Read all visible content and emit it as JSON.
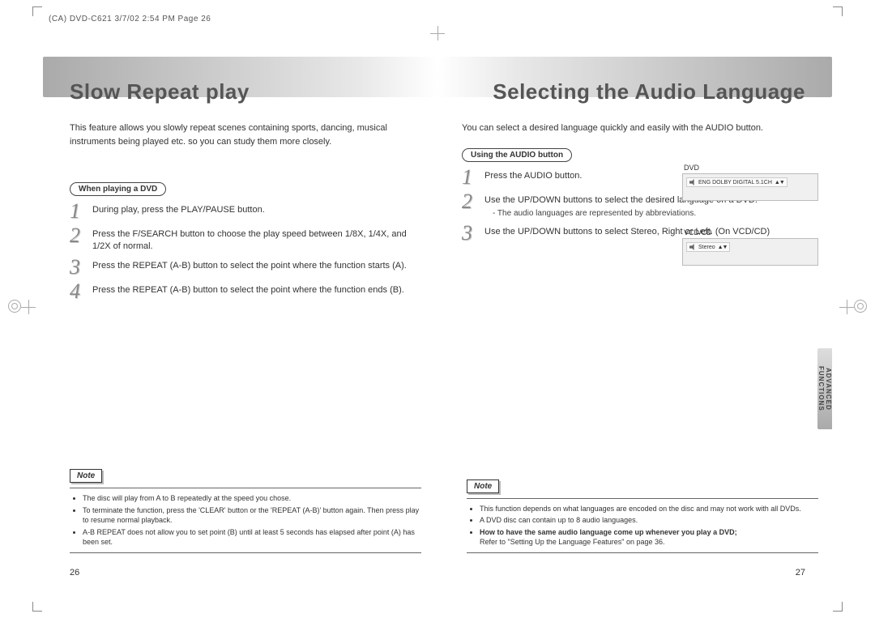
{
  "meta": {
    "header": "(CA) DVD-C621  3/7/02  2:54 PM  Page 26"
  },
  "left": {
    "title": "Slow Repeat play",
    "intro": "This feature allows you slowly repeat scenes containing sports, dancing, musical instruments being played etc. so you can study them more closely.",
    "pill": "When playing a DVD",
    "steps": [
      "During play, press the PLAY/PAUSE button.",
      "Press the F/SEARCH button to choose the play speed between 1/8X, 1/4X, and 1/2X of normal.",
      "Press the REPEAT (A-B) button to select the point where the function starts (A).",
      "Press the REPEAT (A-B) button to select the point where the function ends (B)."
    ],
    "note_label": "Note",
    "notes": [
      "The disc will play from A to B repeatedly at the speed you chose.",
      "To terminate the function, press the 'CLEAR' button or the 'REPEAT (A-B)' button again. Then press play to resume normal playback.",
      "A-B REPEAT does not allow you to set point (B) until at least 5 seconds has elapsed after point (A) has been set."
    ],
    "pagenum": "26"
  },
  "right": {
    "title": "Selecting the Audio Language",
    "intro": "You can select a desired language quickly and easily with the AUDIO button.",
    "pill": "Using the AUDIO button",
    "steps": [
      {
        "text": "Press the AUDIO button.",
        "sub": ""
      },
      {
        "text": "Use the UP/DOWN buttons to select the desired language on a DVD.",
        "sub": "- The audio languages are represented by abbreviations."
      },
      {
        "text": "Use the UP/DOWN buttons to select Stereo, Right or Left. (On VCD/CD)",
        "sub": ""
      }
    ],
    "osd1_label": "DVD",
    "osd1_text": "ENG  DOLBY  DIGITAL  5.1CH",
    "osd2_label": "VCD/CD",
    "osd2_text": "Stereo",
    "note_label": "Note",
    "notes_plain": [
      "This function depends on what languages are encoded on the disc and may not work with all DVDs.",
      "A DVD disc can contain up to 8 audio languages."
    ],
    "note_bold": "How to have the same audio language come up whenever you play a DVD;",
    "note_ref": "Refer to \"Setting Up the Language Features\" on page 36.",
    "pagenum": "27",
    "sidetab": "ADVANCED\nFUNCTIONS"
  }
}
